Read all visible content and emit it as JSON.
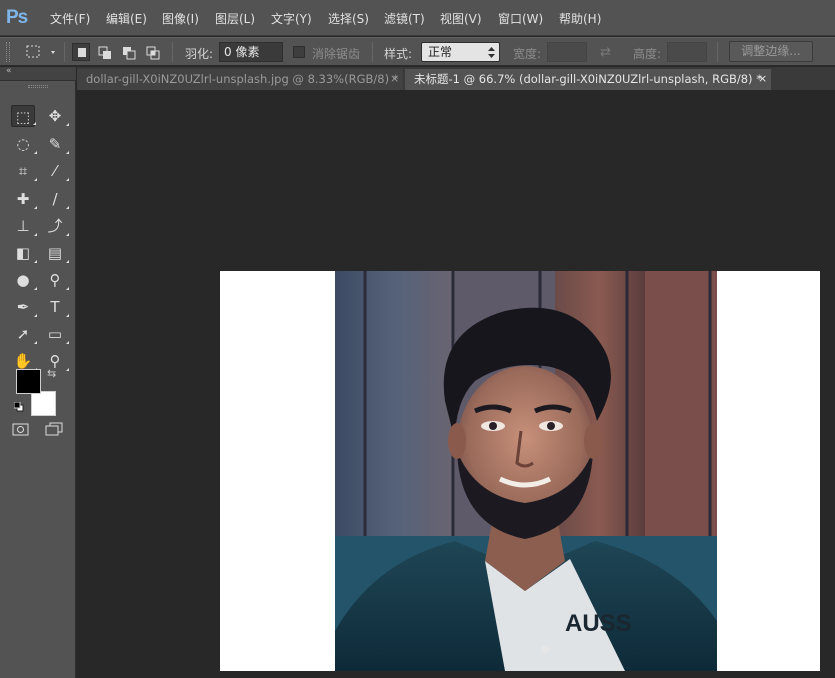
{
  "app": {
    "logo": "Ps"
  },
  "menu": [
    {
      "label": "文件(F)"
    },
    {
      "label": "编辑(E)"
    },
    {
      "label": "图像(I)"
    },
    {
      "label": "图层(L)"
    },
    {
      "label": "文字(Y)"
    },
    {
      "label": "选择(S)"
    },
    {
      "label": "滤镜(T)"
    },
    {
      "label": "视图(V)"
    },
    {
      "label": "窗口(W)"
    },
    {
      "label": "帮助(H)"
    }
  ],
  "options": {
    "feather_label": "羽化:",
    "feather_value": "0 像素",
    "antialias_label": "消除锯齿",
    "style_label": "样式:",
    "style_value": "正常",
    "width_label": "宽度:",
    "height_label": "高度:",
    "refine_edge_label": "调整边缘..."
  },
  "tabs": [
    {
      "title": "dollar-gill-X0iNZ0UZlrl-unsplash.jpg @ 8.33%(RGB/8) *",
      "close": "×"
    },
    {
      "title": "未标题-1 @ 66.7% (dollar-gill-X0iNZ0UZlrl-unsplash, RGB/8) *",
      "close": "×"
    }
  ],
  "tools": [
    {
      "name": "rectangular-marquee-tool",
      "icon": "marquee-icon",
      "glyph": "⬚"
    },
    {
      "name": "move-tool",
      "icon": "move-icon",
      "glyph": "✥"
    },
    {
      "name": "lasso-tool",
      "icon": "lasso-icon",
      "glyph": "◌"
    },
    {
      "name": "quick-selection-tool",
      "icon": "brush-select-icon",
      "glyph": "✎"
    },
    {
      "name": "crop-tool",
      "icon": "crop-icon",
      "glyph": "⌗"
    },
    {
      "name": "eyedropper-tool",
      "icon": "eyedropper-icon",
      "glyph": "⁄"
    },
    {
      "name": "healing-brush-tool",
      "icon": "bandage-icon",
      "glyph": "✚"
    },
    {
      "name": "brush-tool",
      "icon": "brush-icon",
      "glyph": "/"
    },
    {
      "name": "clone-stamp-tool",
      "icon": "stamp-icon",
      "glyph": "⊥"
    },
    {
      "name": "history-brush-tool",
      "icon": "history-brush-icon",
      "glyph": "⤴"
    },
    {
      "name": "eraser-tool",
      "icon": "eraser-icon",
      "glyph": "◧"
    },
    {
      "name": "gradient-tool",
      "icon": "gradient-icon",
      "glyph": "▤"
    },
    {
      "name": "blur-tool",
      "icon": "drop-icon",
      "glyph": "●"
    },
    {
      "name": "dodge-tool",
      "icon": "dodge-icon",
      "glyph": "⚲"
    },
    {
      "name": "pen-tool",
      "icon": "pen-icon",
      "glyph": "✒"
    },
    {
      "name": "type-tool",
      "icon": "type-icon",
      "glyph": "T"
    },
    {
      "name": "path-selection-tool",
      "icon": "arrow-icon",
      "glyph": "➚"
    },
    {
      "name": "rectangle-tool",
      "icon": "rectangle-icon",
      "glyph": "▭"
    },
    {
      "name": "hand-tool",
      "icon": "hand-icon",
      "glyph": "✋"
    },
    {
      "name": "zoom-tool",
      "icon": "zoom-icon",
      "glyph": "⚲"
    }
  ],
  "colors": {
    "foreground": "#000000",
    "background": "#ffffff",
    "accent": "#7fb6ea"
  }
}
